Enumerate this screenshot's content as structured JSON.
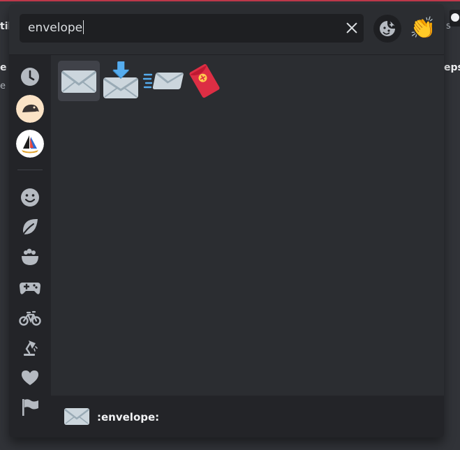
{
  "background": {
    "fragment_left_1": "til",
    "fragment_left_2": "e",
    "fragment_left_3": "e",
    "fragment_right_1": "eps",
    "fragment_right_2": "s"
  },
  "search": {
    "value": "envelope",
    "clear_icon": "close-icon"
  },
  "header": {
    "sticker_icon": "sticker-face-icon",
    "diversity_emoji": "👏"
  },
  "sidebar": {
    "items": [
      {
        "name": "recent",
        "icon": "clock-icon"
      },
      {
        "name": "server-1",
        "icon": "server-icon"
      },
      {
        "name": "server-2",
        "icon": "server-icon"
      },
      {
        "name": "people",
        "icon": "smiley-icon"
      },
      {
        "name": "nature",
        "icon": "leaf-icon"
      },
      {
        "name": "food",
        "icon": "food-bowl-icon"
      },
      {
        "name": "activities",
        "icon": "gamepad-icon"
      },
      {
        "name": "travel",
        "icon": "bicycle-icon"
      },
      {
        "name": "objects",
        "icon": "lamp-icon"
      },
      {
        "name": "symbols",
        "icon": "heart-icon"
      },
      {
        "name": "flags",
        "icon": "flag-icon"
      }
    ]
  },
  "results": [
    {
      "name": "envelope",
      "icon": "envelope-icon"
    },
    {
      "name": "envelope_with_arrow",
      "icon": "envelope-with-arrow-icon"
    },
    {
      "name": "incoming_envelope",
      "icon": "incoming-envelope-icon"
    },
    {
      "name": "red_envelope",
      "icon": "red-envelope-icon"
    }
  ],
  "preview": {
    "label": ":envelope:",
    "icon": "envelope-icon"
  },
  "colors": {
    "picker_bg": "#2b2d31",
    "sidebar_bg": "#232428",
    "input_bg": "#1e1f22",
    "selected_bg": "#404249",
    "icon_grey": "#b5bac1"
  }
}
